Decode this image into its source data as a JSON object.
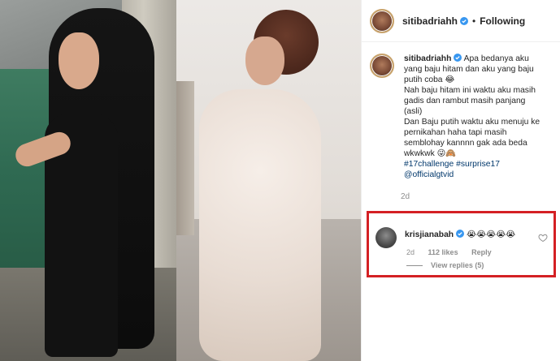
{
  "post": {
    "username": "sitibadriahh",
    "follow_status": "Following",
    "separator": "•",
    "caption_lines": [
      "Apa bedanya aku",
      "yang baju hitam dan aku yang baju",
      "putih coba 😂",
      "Nah baju hitam ini waktu aku masih",
      "gadis dan rambut masih panjang",
      "(asli)",
      "Dan Baju putih waktu aku menuju ke",
      "pernikahan haha tapi masih",
      "semblohay kannnn gak ada beda",
      "wkwkwk 😜🙈"
    ],
    "hashtags": "#17challenge #surprise17",
    "mention": "@officialgtvid",
    "time": "2d"
  },
  "comment": {
    "username": "krisjianabah",
    "text": "😭😭😭😭😭",
    "time": "2d",
    "likes": "112 likes",
    "reply": "Reply",
    "view_replies": "View replies (5)"
  },
  "colors": {
    "highlight_border": "#d42024",
    "verified": "#3897f0",
    "link": "#00376b"
  },
  "icons": {
    "verified": "verified-badge-icon",
    "like": "heart-icon"
  }
}
